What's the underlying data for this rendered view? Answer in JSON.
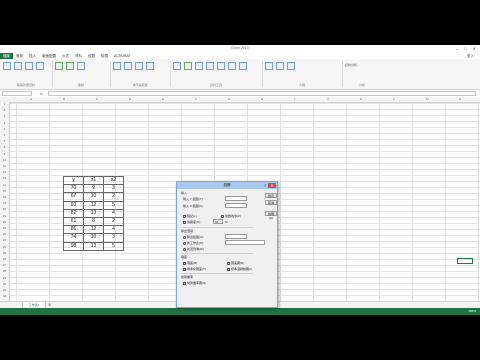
{
  "window": {
    "title": "Excel 2013"
  },
  "menu": {
    "file_label": "檔案",
    "tabs": [
      "常用",
      "插入",
      "版面配置",
      "公式",
      "資料",
      "校閱",
      "檢視",
      "ACROBAT"
    ],
    "user": "登入"
  },
  "ribbon": {
    "groups": [
      "取得外部資料",
      "連線",
      "排序與篩選",
      "資料工具",
      "大綱",
      "分析"
    ],
    "analysis_item": "資料分析"
  },
  "sheet": {
    "columns": [
      "A",
      "B",
      "C",
      "D",
      "E",
      "F",
      "G",
      "H",
      "I",
      "J",
      "K",
      "L",
      "M",
      "N"
    ],
    "rows": [
      "1",
      "2",
      "3",
      "4",
      "5",
      "6",
      "7",
      "8",
      "9",
      "10",
      "11",
      "12",
      "13",
      "14",
      "15",
      "16",
      "17",
      "18",
      "19",
      "20",
      "21",
      "22",
      "23",
      "24",
      "25",
      "26",
      "27",
      "28",
      "29",
      "30",
      "31",
      "32"
    ],
    "table_headers": [
      "y",
      "x1",
      "x2"
    ],
    "table_rows": [
      [
        "70",
        "9",
        "3"
      ],
      [
        "67",
        "10",
        "2"
      ],
      [
        "93",
        "12",
        "5"
      ],
      [
        "82",
        "13",
        "4"
      ],
      [
        "61",
        "8",
        "2"
      ],
      [
        "86",
        "12",
        "4"
      ],
      [
        "74",
        "10",
        "3"
      ],
      [
        "98",
        "13",
        "5"
      ]
    ],
    "tab_name": "工作表1",
    "add_sheet": "⊕"
  },
  "status": {
    "zoom": "100%"
  },
  "dialog": {
    "title": "迴歸",
    "help": "?",
    "close": "✕",
    "input_section": "輸入",
    "input_y_label": "輸入 Y 範圍(Y):",
    "input_x_label": "輸入 X 範圍(X):",
    "labels_checkbox": "標記(L)",
    "constant_zero_checkbox": "常數為零(Z)",
    "confidence_checkbox": "信賴度(O)",
    "confidence_value": "95",
    "confidence_unit": "%",
    "output_section": "輸出選項",
    "output_range_label": "輸出範圍(O):",
    "new_worksheet_label": "新工作表(P):",
    "new_workbook_label": "新活頁簿(W)",
    "residuals_section": "殘差",
    "residuals_checkbox": "殘差(R)",
    "std_residuals_checkbox": "標準化殘差(T)",
    "residual_plots_checkbox": "殘差圖(D)",
    "line_fit_checkbox": "樣本迴歸線圖(I)",
    "normal_section": "常態機率",
    "normal_plot_checkbox": "常態機率圖(N)",
    "ok_button": "確定",
    "cancel_button": "取消",
    "help_button": "說明(H)"
  },
  "colors": {
    "excel_green": "#217346",
    "dialog_title": "#a9c9ee"
  }
}
